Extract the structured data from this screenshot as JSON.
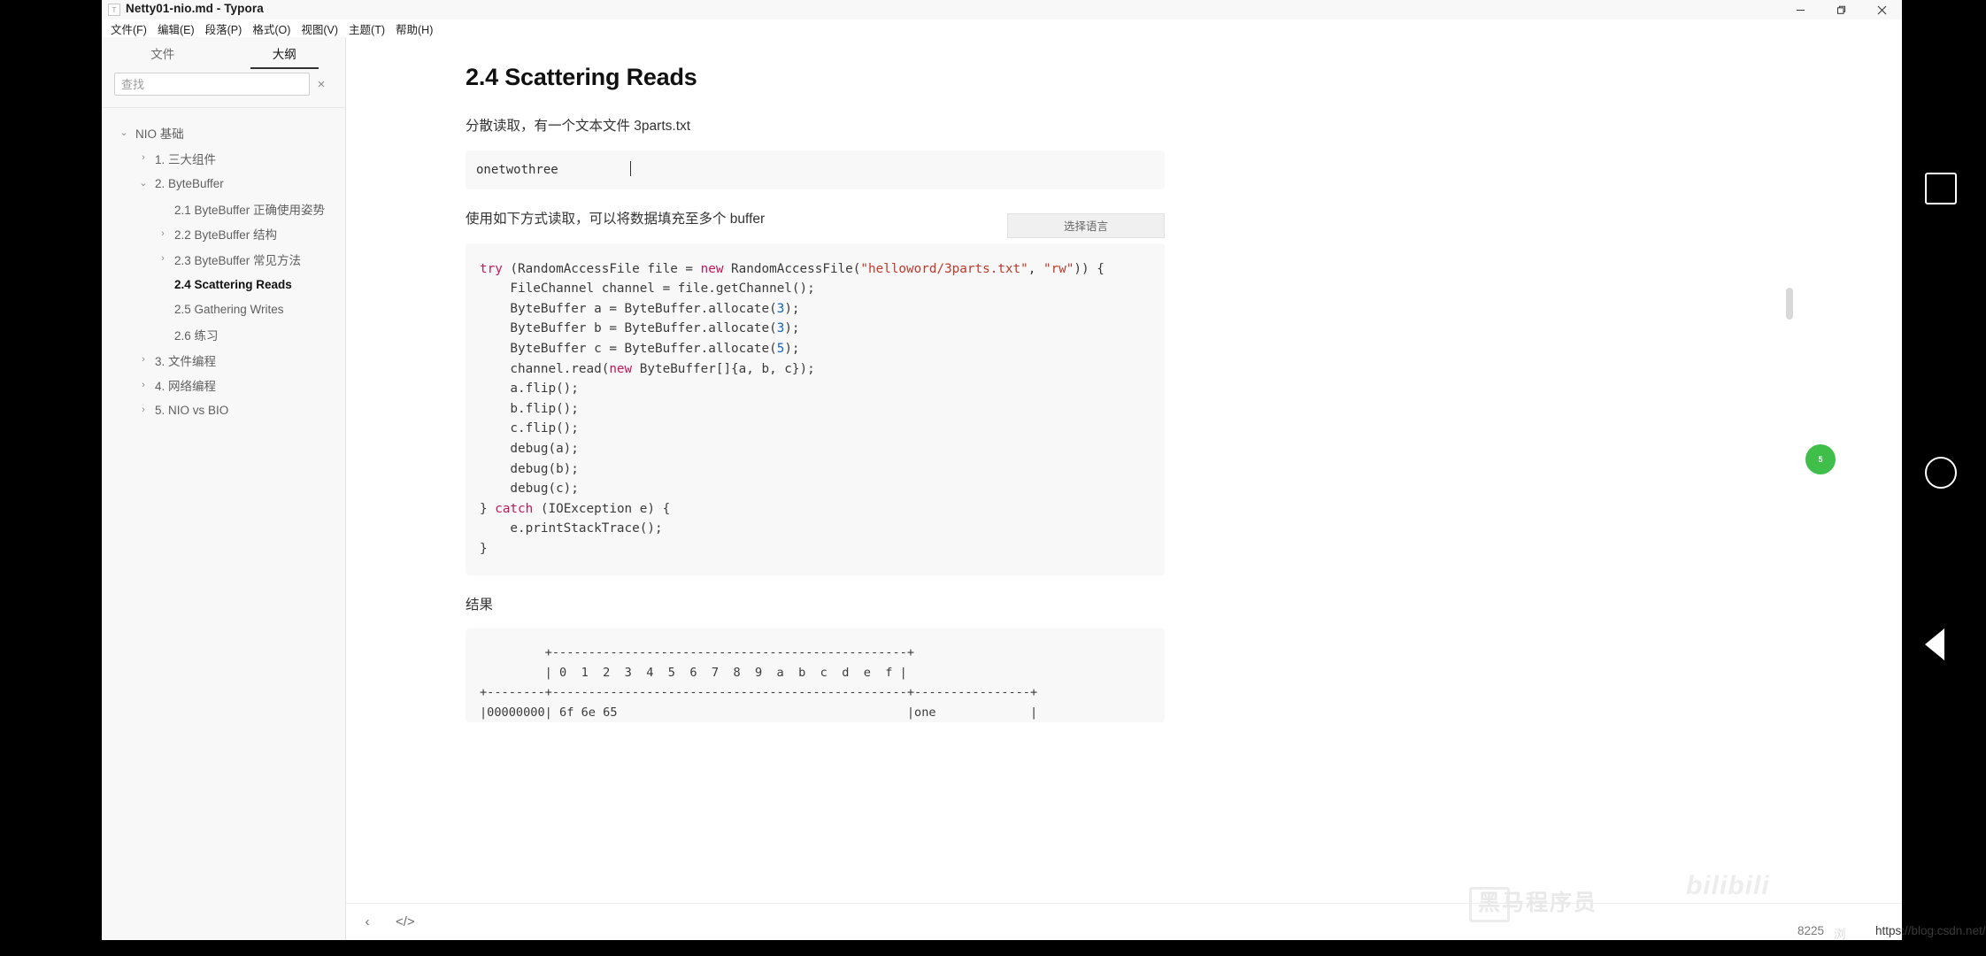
{
  "window": {
    "title": "Netty01-nio.md - Typora",
    "app_badge": "T",
    "controls": {
      "minimize": "minimize-icon",
      "restore": "restore-icon",
      "close": "close-icon"
    }
  },
  "menubar": [
    {
      "label": "文件(F)"
    },
    {
      "label": "编辑(E)"
    },
    {
      "label": "段落(P)"
    },
    {
      "label": "格式(O)"
    },
    {
      "label": "视图(V)"
    },
    {
      "label": "主题(T)"
    },
    {
      "label": "帮助(H)"
    }
  ],
  "sidebar": {
    "tabs": [
      {
        "label": "文件",
        "active": false
      },
      {
        "label": "大纲",
        "active": true
      }
    ],
    "search": {
      "placeholder": "查找",
      "value": "",
      "clear": "×"
    },
    "outline": [
      {
        "label": "NIO 基础",
        "level": 0,
        "caret": "⌄",
        "active": false
      },
      {
        "label": "1. 三大组件",
        "level": 1,
        "caret": "›",
        "active": false
      },
      {
        "label": "2. ByteBuffer",
        "level": 1,
        "caret": "⌄",
        "active": false
      },
      {
        "label": "2.1 ByteBuffer 正确使用姿势",
        "level": 2,
        "caret": "",
        "active": false
      },
      {
        "label": "2.2 ByteBuffer 结构",
        "level": 2,
        "caret": "›",
        "active": false
      },
      {
        "label": "2.3 ByteBuffer 常见方法",
        "level": 2,
        "caret": "›",
        "active": false
      },
      {
        "label": "2.4 Scattering Reads",
        "level": 2,
        "caret": "",
        "active": true
      },
      {
        "label": "2.5 Gathering Writes",
        "level": 2,
        "caret": "",
        "active": false
      },
      {
        "label": "2.6 练习",
        "level": 2,
        "caret": "",
        "active": false
      },
      {
        "label": "3. 文件编程",
        "level": 1,
        "caret": "›",
        "active": false
      },
      {
        "label": "4. 网络编程",
        "level": 1,
        "caret": "›",
        "active": false
      },
      {
        "label": "5. NIO vs BIO",
        "level": 1,
        "caret": "›",
        "active": false
      }
    ]
  },
  "document": {
    "heading": "2.4 Scattering Reads",
    "para1": "分散读取，有一个文本文件 3parts.txt",
    "file_preview": "onetwothree",
    "para2": "使用如下方式读取，可以将数据填充至多个 buffer",
    "lang_picker": "选择语言",
    "code_lines": [
      {
        "parts": [
          {
            "t": "try",
            "c": "k"
          },
          {
            "t": " (RandomAccessFile file = ",
            "c": ""
          },
          {
            "t": "new",
            "c": "k"
          },
          {
            "t": " RandomAccessFile(",
            "c": ""
          },
          {
            "t": "\"helloword/3parts.txt\"",
            "c": "s"
          },
          {
            "t": ", ",
            "c": ""
          },
          {
            "t": "\"rw\"",
            "c": "s"
          },
          {
            "t": ")) {",
            "c": ""
          }
        ]
      },
      {
        "parts": [
          {
            "t": "    FileChannel channel = file.getChannel();",
            "c": ""
          }
        ]
      },
      {
        "parts": [
          {
            "t": "    ByteBuffer a = ByteBuffer.allocate(",
            "c": ""
          },
          {
            "t": "3",
            "c": "n"
          },
          {
            "t": ");",
            "c": ""
          }
        ]
      },
      {
        "parts": [
          {
            "t": "    ByteBuffer b = ByteBuffer.allocate(",
            "c": ""
          },
          {
            "t": "3",
            "c": "n"
          },
          {
            "t": ");",
            "c": ""
          }
        ]
      },
      {
        "parts": [
          {
            "t": "    ByteBuffer c = ByteBuffer.allocate(",
            "c": ""
          },
          {
            "t": "5",
            "c": "n"
          },
          {
            "t": ");",
            "c": ""
          }
        ]
      },
      {
        "parts": [
          {
            "t": "    channel.read(",
            "c": ""
          },
          {
            "t": "new",
            "c": "k"
          },
          {
            "t": " ByteBuffer[]{a, b, c});",
            "c": ""
          }
        ]
      },
      {
        "parts": [
          {
            "t": "    a.flip();",
            "c": ""
          }
        ]
      },
      {
        "parts": [
          {
            "t": "    b.flip();",
            "c": ""
          }
        ]
      },
      {
        "parts": [
          {
            "t": "    c.flip();",
            "c": ""
          }
        ]
      },
      {
        "parts": [
          {
            "t": "    debug(a);",
            "c": ""
          }
        ]
      },
      {
        "parts": [
          {
            "t": "    debug(b);",
            "c": ""
          }
        ]
      },
      {
        "parts": [
          {
            "t": "    debug(c);",
            "c": ""
          }
        ]
      },
      {
        "parts": [
          {
            "t": "} ",
            "c": ""
          },
          {
            "t": "catch",
            "c": "k"
          },
          {
            "t": " (IOException e) {",
            "c": ""
          }
        ]
      },
      {
        "parts": [
          {
            "t": "    e.printStackTrace();",
            "c": ""
          }
        ]
      },
      {
        "parts": [
          {
            "t": "}",
            "c": ""
          }
        ]
      }
    ],
    "result_label": "结果",
    "hex_lines": [
      "         +-------------------------------------------------+",
      "         | 0  1  2  3  4  5  6  7  8  9  a  b  c  d  e  f |",
      "+--------+-------------------------------------------------+----------------+",
      "|00000000| 6f 6e 65                                        |one             |"
    ]
  },
  "statusbar": {
    "back": "‹",
    "source": "</>"
  },
  "overlay": {
    "square": "square-icon",
    "circle": "circle-icon",
    "triangle": "play-icon",
    "badge": "5"
  },
  "watermarks": {
    "heima": "黑马程序员",
    "bilibili": "bilibili",
    "counter": "8225",
    "counter_suffix": "浏",
    "url": "https://blog.csdn.net/BOWWOB"
  },
  "colors": {
    "keyword": "#c2185b",
    "string": "#c0392b",
    "number": "#1565c0",
    "accent_green": "#3fbf4a",
    "sidebar_bg": "#f8f8f8",
    "code_bg": "#f8f8f8"
  }
}
